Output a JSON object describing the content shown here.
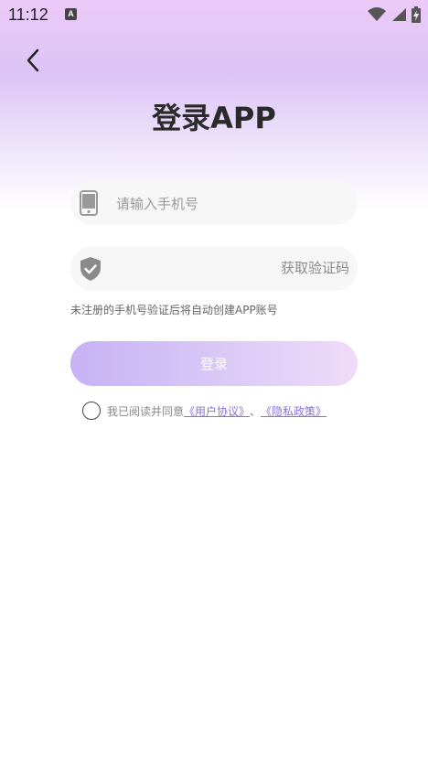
{
  "status_bar": {
    "time": "11:12",
    "notification_icon_letter": "A",
    "icons": [
      "wifi-icon",
      "signal-icon",
      "battery-charging-icon"
    ]
  },
  "header": {
    "back_icon": "chevron-left-icon",
    "title": "登录APP"
  },
  "form": {
    "phone": {
      "icon": "phone-icon",
      "placeholder": "请输入手机号",
      "value": ""
    },
    "code": {
      "icon": "shield-check-icon",
      "placeholder": "",
      "value": "",
      "get_code_label": "获取验证码"
    },
    "hint": "未注册的手机号验证后将自动创建APP账号",
    "login_label": "登录"
  },
  "agreement": {
    "checked": false,
    "prefix": "我已阅读并同意",
    "user_agreement": "《用户协议》",
    "separator": "、",
    "privacy_policy": "《隐私政策》"
  },
  "colors": {
    "accent_link": "#8d6fd8",
    "button_gradient_start": "#c6b2f5",
    "button_gradient_end": "#efdcf9",
    "header_gradient": "#dcc4f6"
  }
}
